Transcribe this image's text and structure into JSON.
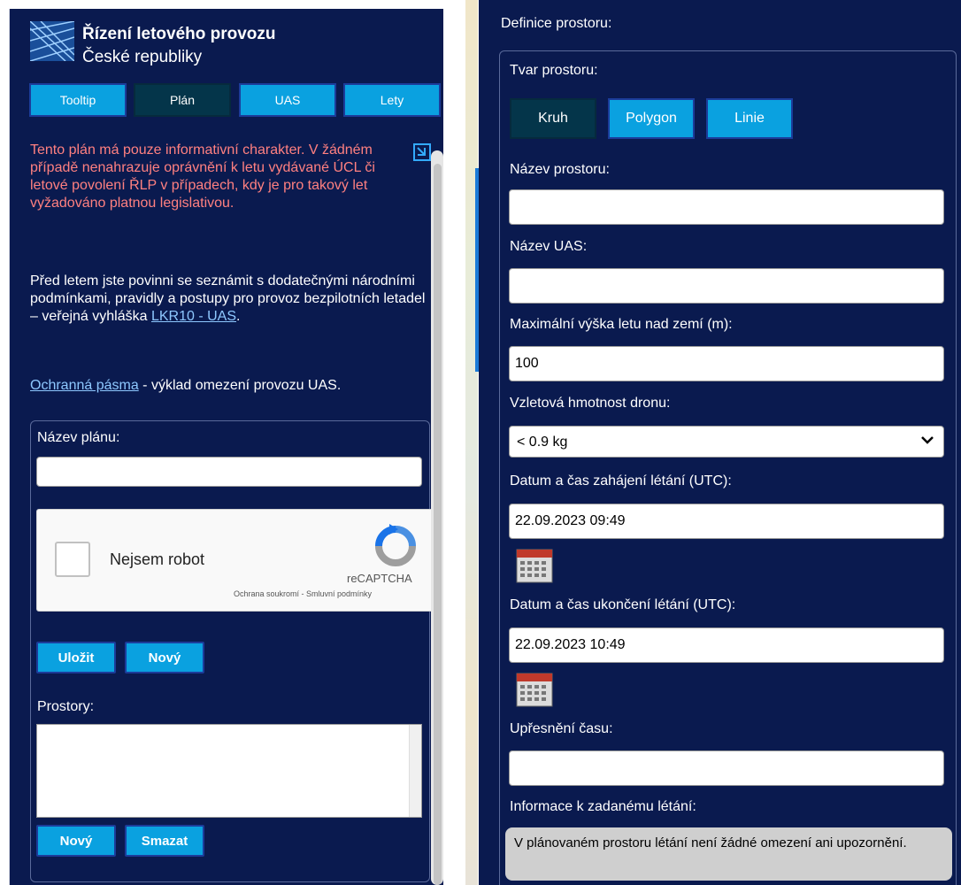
{
  "header": {
    "title_line1": "Řízení letového provozu",
    "title_line2": "České republiky"
  },
  "tabs": [
    {
      "label": "Tooltip",
      "active": false
    },
    {
      "label": "Plán",
      "active": true
    },
    {
      "label": "UAS",
      "active": false
    },
    {
      "label": "Lety",
      "active": false
    }
  ],
  "warning_text": "Tento plán má pouze informativní charakter. V žádném případě nenahrazuje oprávnění k letu vydávané ÚCL či letové povolení ŘLP v případech, kdy je pro takový let vyžadováno platnou legislativou.",
  "info": {
    "text_before_link": "Před letem jste povinni se seznámit s dodatečnými národními podmínkami, pravidly a postupy pro provoz bezpilotních letadel – veřejná vyhláška ",
    "link": "LKR10 - UAS",
    "text_after_link": "."
  },
  "protection": {
    "link": "Ochranná pásma",
    "text": " - výklad omezení provozu UAS."
  },
  "plan_form": {
    "name_label": "Název plánu:",
    "name_value": "",
    "captcha": {
      "label": "Nejsem robot",
      "brand": "reCAPTCHA",
      "links": "Ochrana soukromí - Smluvní podmínky"
    },
    "save_label": "Uložit",
    "new_label": "Nový",
    "spaces_label": "Prostory:",
    "space_new_label": "Nový",
    "space_delete_label": "Smazat"
  },
  "space_def": {
    "title": "Definice prostoru:",
    "shape_label": "Tvar prostoru:",
    "shapes": [
      {
        "label": "Kruh",
        "active": true
      },
      {
        "label": "Polygon",
        "active": false
      },
      {
        "label": "Linie",
        "active": false
      }
    ],
    "name_label": "Název prostoru:",
    "name_value": "",
    "uas_label": "Název UAS:",
    "uas_value": "",
    "height_label": "Maximální výška letu nad zemí (m):",
    "height_value": "100",
    "weight_label": "Vzletová hmotnost dronu:",
    "weight_value": "< 0.9 kg",
    "start_label": "Datum a čas zahájení létání (UTC):",
    "start_value": "22.09.2023 09:49",
    "end_label": "Datum a čas ukončení létání (UTC):",
    "end_value": "22.09.2023 10:49",
    "time_spec_label": "Upřesnění času:",
    "time_spec_value": "",
    "info_label": "Informace k zadanému létání:",
    "info_text": "V plánovaném prostoru létání není žádné omezení ani upozornění."
  },
  "colors": {
    "panel_bg": "#0a1a4f",
    "button_bg": "#0aa1e0",
    "button_active_bg": "#04354a",
    "warning": "#ff8080",
    "link": "#8ec8ff"
  }
}
